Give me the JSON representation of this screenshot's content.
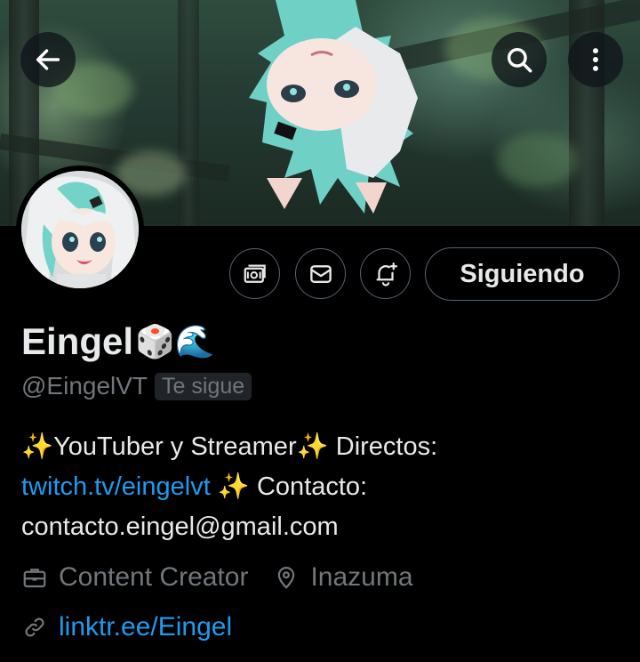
{
  "header": {
    "back_icon": "arrow-left-icon",
    "search_icon": "search-icon",
    "more_icon": "more-vertical-icon"
  },
  "profile": {
    "name": "Eingel",
    "name_emojis": "🎲🌊",
    "handle": "@EingelVT",
    "follows_you": "Te sigue"
  },
  "actions": {
    "subscribe_icon": "subscriptions-icon",
    "message_icon": "envelope-icon",
    "notify_icon": "bell-plus-icon",
    "follow_label": "Siguiendo"
  },
  "bio": {
    "line1": "✨YouTuber y Streamer✨ Directos:",
    "link": "twitch.tv/eingelvt",
    "line2_rest": " ✨ Contacto:",
    "line3": "contacto.eingel@gmail.com"
  },
  "meta": {
    "category": "Content Creator",
    "location": "Inazuma",
    "website": "linktr.ee/Eingel"
  },
  "colors": {
    "background": "#000000",
    "text": "#e7e9ea",
    "muted": "#71767b",
    "link": "#1d9bf0",
    "border": "#536471"
  }
}
